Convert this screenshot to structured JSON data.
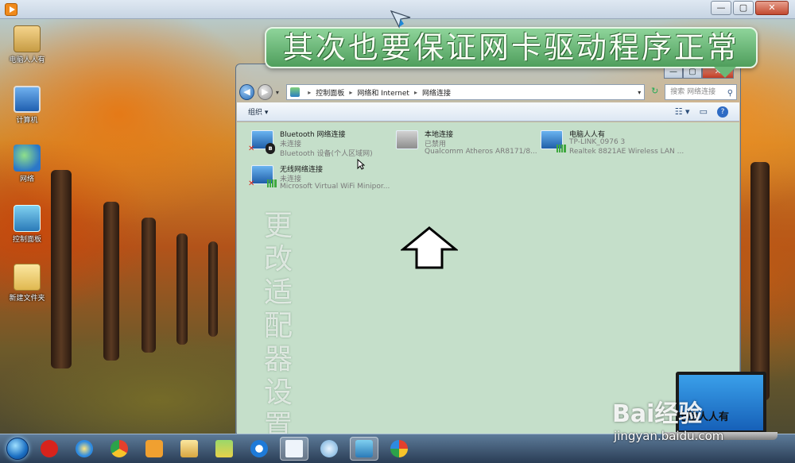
{
  "player": {
    "controls": {
      "minimize": "—",
      "maximize": "▢",
      "close": "✕"
    }
  },
  "desktop": {
    "icons": [
      {
        "label": "电脑人人有"
      },
      {
        "label": "计算机"
      },
      {
        "label": "网络"
      },
      {
        "label": "控制面板"
      },
      {
        "label": "新建文件夹"
      }
    ]
  },
  "banner": {
    "text": "其次也要保证网卡驱动程序正常"
  },
  "window": {
    "controls": {
      "minimize": "—",
      "maximize": "▢",
      "close": "✕"
    },
    "address": {
      "crumbs": [
        "控制面板",
        "网络和 Internet",
        "网络连接"
      ],
      "search_placeholder": "搜索 网络连接"
    },
    "toolbar": {
      "organize_label": "组织 ▾",
      "help": "?"
    },
    "connections": [
      {
        "name": "Bluetooth 网络连接",
        "status": "未连接",
        "device": "Bluetooth 设备(个人区域网)",
        "state": "disconnected",
        "icon": "bluetooth-icon"
      },
      {
        "name": "本地连接",
        "status": "已禁用",
        "device": "Qualcomm Atheros AR8171/8...",
        "state": "disabled",
        "icon": "ethernet-icon"
      },
      {
        "name": "电脑人人有",
        "status": "TP-LINK_0976  3",
        "device": "Realtek 8821AE Wireless LAN ...",
        "state": "connected",
        "icon": "wifi-icon"
      },
      {
        "name": "无线网络连接",
        "status": "未连接",
        "device": "Microsoft Virtual WiFi Minipor...",
        "state": "disconnected",
        "icon": "wifi-icon"
      }
    ],
    "annotation_vertical": [
      "更",
      "改",
      "适",
      "配",
      "器",
      "设",
      "置"
    ]
  },
  "watermark": {
    "brand": "Bai经验",
    "laptop_text": "电脑人人有",
    "url": "jingyan.baidu.com"
  },
  "colors": {
    "banner_green": "#6bb877",
    "content_bg": "#c5dfca",
    "error_red": "#d8261c"
  }
}
